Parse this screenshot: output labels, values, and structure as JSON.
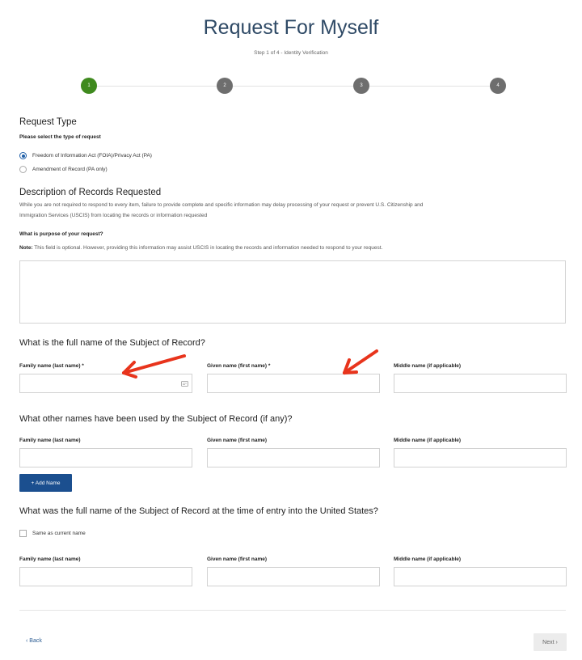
{
  "header": {
    "title": "Request For Myself",
    "subtitle": "Step 1 of 4 - Identity Verification"
  },
  "steps": [
    "1",
    "2",
    "3",
    "4"
  ],
  "request_type": {
    "heading": "Request Type",
    "prompt": "Please select the type of request",
    "options": [
      {
        "label": "Freedom of Information Act (FOIA)/Privacy Act (PA)",
        "checked": true
      },
      {
        "label": "Amendment of Record (PA only)",
        "checked": false
      }
    ]
  },
  "description": {
    "heading": "Description of Records Requested",
    "text_line1": "While you are not required to respond to every item, failure to provide complete and specific information may delay processing of your request or prevent U.S. Citizenship and",
    "text_line2": "Immigration Services (USCIS) from locating the records or information requested",
    "purpose_label": "What is purpose of your request?",
    "note_bold": "Note:",
    "note_text": " This field is optional. However, providing this information may assist USCIS in locating the records and information needed to respond to your request.",
    "purpose_value": ""
  },
  "full_name": {
    "question": "What is the full name of the Subject of Record?",
    "family_label": "Family name (last name) *",
    "given_label": "Given name (first name) *",
    "middle_label": "Middle name (if applicable)"
  },
  "other_names": {
    "question": "What other names have been used by the Subject of Record (if any)?",
    "family_label": "Family name (last name)",
    "given_label": "Given name (first name)",
    "middle_label": "Middle name (if applicable)",
    "add_button": "+ Add Name"
  },
  "entry_name": {
    "question": "What was the full name of the Subject of Record at the time of entry into the United States?",
    "same_as_current": "Same as current name",
    "family_label": "Family name (last name)",
    "given_label": "Given name (first name)",
    "middle_label": "Middle name (if applicable)"
  },
  "nav": {
    "back": "‹ Back",
    "next": "Next ›"
  },
  "colors": {
    "title": "#2f4a66",
    "active_step": "#3f8a1e",
    "inactive_step": "#6e6e6e",
    "primary_button": "#1b4f8f",
    "annotation_arrow": "#e8341c"
  }
}
